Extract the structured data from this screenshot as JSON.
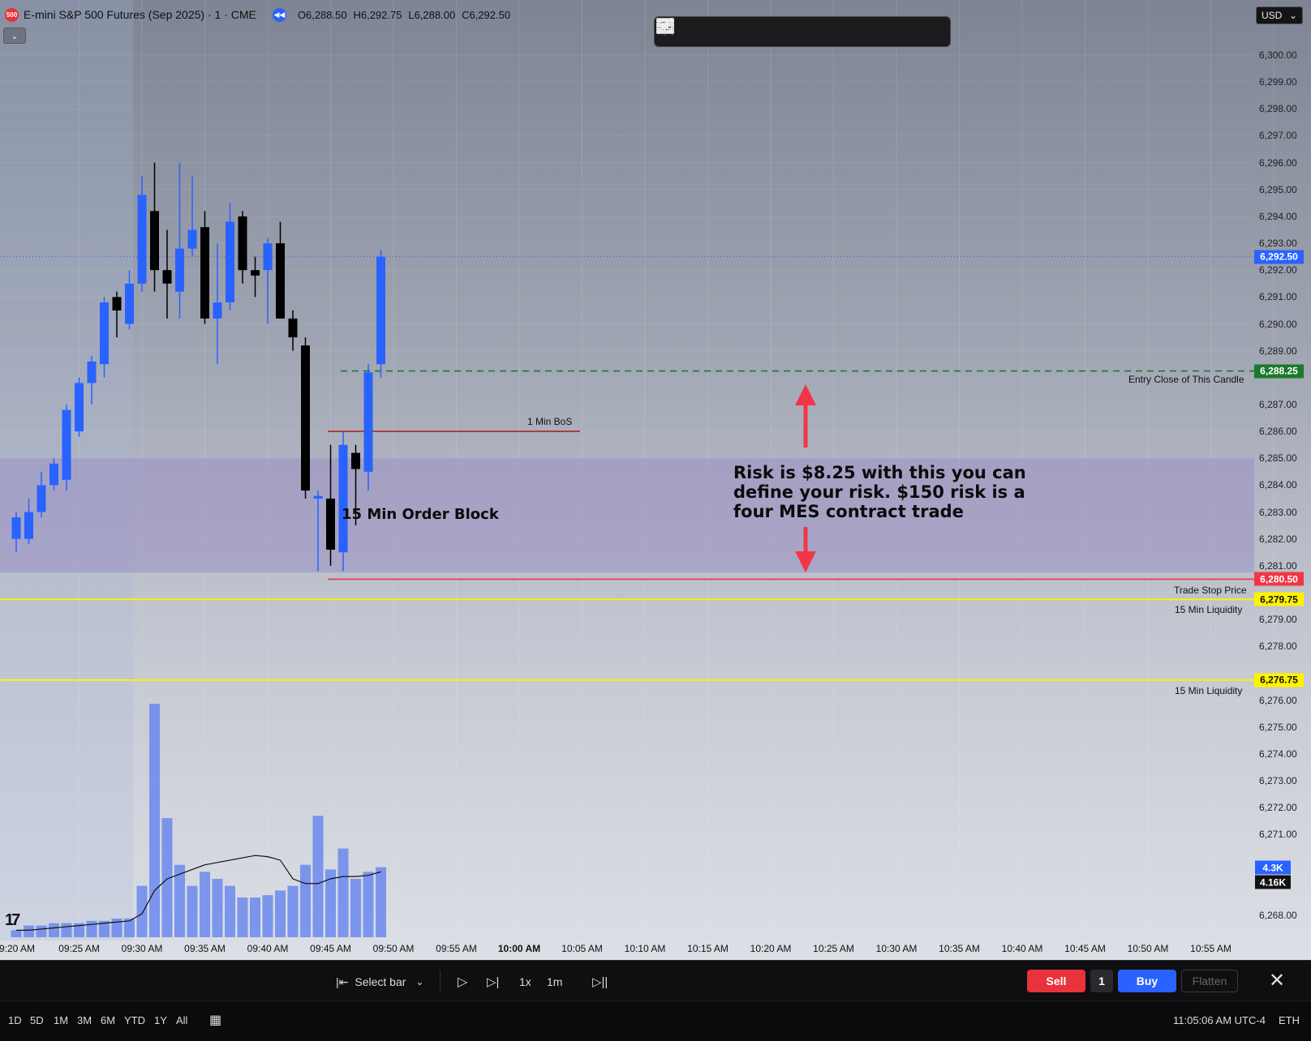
{
  "header": {
    "symbol_badge": "500",
    "title": "E-mini S&P 500 Futures (Sep 2025) · 1 · CME",
    "ohlc": [
      "O6,288.50",
      "H6,292.75",
      "L6,288.00",
      "C6,292.50"
    ],
    "currency": "USD"
  },
  "price_axis": {
    "ticks": [
      "6,300.00",
      "6,299.00",
      "6,298.00",
      "6,297.00",
      "6,296.00",
      "6,295.00",
      "6,294.00",
      "6,293.00",
      "6,292.00",
      "6,291.00",
      "6,290.00",
      "6,289.00",
      "6,287.00",
      "6,286.00",
      "6,285.00",
      "6,284.00",
      "6,283.00",
      "6,282.00",
      "6,281.00",
      "6,279.00",
      "6,278.00",
      "6,276.00",
      "6,275.00",
      "6,274.00",
      "6,273.00",
      "6,272.00",
      "6,271.00",
      "6,268.00"
    ]
  },
  "badges": [
    {
      "price": 6292.5,
      "label": "6,292.50",
      "bg": "#2962ff",
      "fg": "#ffffff"
    },
    {
      "price": 6288.25,
      "label": "6,288.25",
      "bg": "#1b7a2c",
      "fg": "#ffffff"
    },
    {
      "price": 6280.5,
      "label": "6,280.50",
      "bg": "#f23645",
      "fg": "#ffffff"
    },
    {
      "price": 6279.75,
      "label": "6,279.75",
      "bg": "#fff200",
      "fg": "#111111"
    },
    {
      "price": 6276.75,
      "label": "6,276.75",
      "bg": "#fff200",
      "fg": "#111111"
    }
  ],
  "volume_badges": [
    {
      "label": "4.3K",
      "bg": "#2962ff",
      "fg": "#ffffff"
    },
    {
      "label": "4.16K",
      "bg": "#111111",
      "fg": "#ffffff"
    }
  ],
  "time_axis": [
    "9:20 AM",
    "09:25 AM",
    "09:30 AM",
    "09:35 AM",
    "09:40 AM",
    "09:45 AM",
    "09:50 AM",
    "09:55 AM",
    "10:00 AM",
    "10:05 AM",
    "10:10 AM",
    "10:15 AM",
    "10:20 AM",
    "10:25 AM",
    "10:30 AM",
    "10:35 AM",
    "10:40 AM",
    "10:45 AM",
    "10:50 AM",
    "10:55 AM"
  ],
  "annotations": {
    "entry_label": "Entry Close of This Candle",
    "bos_label": "1 Min BoS",
    "order_block_label": "15 Min Order Block",
    "risk_lines": [
      "Risk is $8.25 with this you can",
      "define your risk. $150 risk is a",
      "four MES contract trade"
    ],
    "stop_label": "Trade Stop Price",
    "liquidity_label_1": "15 Min Liquidity",
    "liquidity_label_2": "15 Min Liquidity"
  },
  "colors": {
    "bull": "#2962ff",
    "bear": "#000000",
    "entry_line": "#1b7a2c",
    "stop_line": "#f23645",
    "liquidity_line": "#fff200",
    "order_block": "#9b8fc4",
    "arrow": "#f23645"
  },
  "chart_data": {
    "type": "candlestick",
    "y_range": [
      6267.5,
      6302.0
    ],
    "x_range": [
      "09:20",
      "10:59"
    ],
    "candles": [
      {
        "t": "09:20",
        "o": 6282.0,
        "h": 6283.0,
        "l": 6281.5,
        "c": 6282.8
      },
      {
        "t": "09:21",
        "o": 6282.0,
        "h": 6283.5,
        "l": 6281.8,
        "c": 6283.0
      },
      {
        "t": "09:22",
        "o": 6283.0,
        "h": 6284.5,
        "l": 6282.8,
        "c": 6284.0
      },
      {
        "t": "09:23",
        "o": 6284.0,
        "h": 6285.0,
        "l": 6283.8,
        "c": 6284.8
      },
      {
        "t": "09:24",
        "o": 6284.2,
        "h": 6287.0,
        "l": 6283.8,
        "c": 6286.8
      },
      {
        "t": "09:25",
        "o": 6286.0,
        "h": 6288.0,
        "l": 6285.8,
        "c": 6287.8
      },
      {
        "t": "09:26",
        "o": 6287.8,
        "h": 6288.8,
        "l": 6287.0,
        "c": 6288.6
      },
      {
        "t": "09:27",
        "o": 6288.5,
        "h": 6291.0,
        "l": 6288.0,
        "c": 6290.8
      },
      {
        "t": "09:28",
        "o": 6291.0,
        "h": 6291.2,
        "l": 6289.5,
        "c": 6290.5
      },
      {
        "t": "09:29",
        "o": 6290.0,
        "h": 6292.0,
        "l": 6289.8,
        "c": 6291.5
      },
      {
        "t": "09:30",
        "o": 6291.5,
        "h": 6295.5,
        "l": 6291.2,
        "c": 6294.8
      },
      {
        "t": "09:31",
        "o": 6294.2,
        "h": 6296.0,
        "l": 6291.2,
        "c": 6292.0
      },
      {
        "t": "09:32",
        "o": 6292.0,
        "h": 6293.5,
        "l": 6290.2,
        "c": 6291.5
      },
      {
        "t": "09:33",
        "o": 6291.2,
        "h": 6296.0,
        "l": 6290.2,
        "c": 6292.8
      },
      {
        "t": "09:34",
        "o": 6292.8,
        "h": 6295.5,
        "l": 6292.5,
        "c": 6293.5
      },
      {
        "t": "09:35",
        "o": 6293.6,
        "h": 6294.2,
        "l": 6290.0,
        "c": 6290.2
      },
      {
        "t": "09:36",
        "o": 6290.2,
        "h": 6293.0,
        "l": 6288.5,
        "c": 6290.8
      },
      {
        "t": "09:37",
        "o": 6290.8,
        "h": 6294.5,
        "l": 6290.5,
        "c": 6293.8
      },
      {
        "t": "09:38",
        "o": 6294.0,
        "h": 6294.2,
        "l": 6291.5,
        "c": 6292.0
      },
      {
        "t": "09:39",
        "o": 6292.0,
        "h": 6292.5,
        "l": 6291.0,
        "c": 6291.8
      },
      {
        "t": "09:40",
        "o": 6292.0,
        "h": 6293.2,
        "l": 6290.0,
        "c": 6293.0
      },
      {
        "t": "09:41",
        "o": 6293.0,
        "h": 6293.8,
        "l": 6290.2,
        "c": 6290.2
      },
      {
        "t": "09:42",
        "o": 6290.2,
        "h": 6290.5,
        "l": 6289.0,
        "c": 6289.5
      },
      {
        "t": "09:43",
        "o": 6289.2,
        "h": 6289.5,
        "l": 6283.5,
        "c": 6283.8
      },
      {
        "t": "09:44",
        "o": 6283.5,
        "h": 6283.8,
        "l": 6280.8,
        "c": 6283.6
      },
      {
        "t": "09:45",
        "o": 6283.5,
        "h": 6285.5,
        "l": 6281.0,
        "c": 6281.6
      },
      {
        "t": "09:46",
        "o": 6281.5,
        "h": 6286.0,
        "l": 6280.8,
        "c": 6285.5
      },
      {
        "t": "09:47",
        "o": 6285.2,
        "h": 6285.5,
        "l": 6282.5,
        "c": 6284.6
      },
      {
        "t": "09:48",
        "o": 6284.5,
        "h": 6288.5,
        "l": 6283.8,
        "c": 6288.2
      },
      {
        "t": "09:49",
        "o": 6288.5,
        "h": 6292.75,
        "l": 6288.0,
        "c": 6292.5
      }
    ],
    "volume": [
      0.03,
      0.05,
      0.05,
      0.06,
      0.06,
      0.06,
      0.07,
      0.07,
      0.08,
      0.08,
      0.22,
      1.0,
      0.51,
      0.31,
      0.22,
      0.28,
      0.25,
      0.22,
      0.17,
      0.17,
      0.18,
      0.2,
      0.22,
      0.31,
      0.52,
      0.29,
      0.38,
      0.25,
      0.28,
      0.3
    ],
    "volume_ma": [
      0.03,
      0.03,
      0.035,
      0.04,
      0.045,
      0.05,
      0.055,
      0.06,
      0.065,
      0.07,
      0.1,
      0.2,
      0.25,
      0.27,
      0.29,
      0.31,
      0.32,
      0.33,
      0.34,
      0.35,
      0.345,
      0.33,
      0.25,
      0.23,
      0.23,
      0.25,
      0.26,
      0.26,
      0.265,
      0.28
    ],
    "levels": [
      {
        "name": "Entry Close of This Candle",
        "price": 6288.25
      },
      {
        "name": "1 Min BoS",
        "price": 6286.0
      },
      {
        "name": "Trade Stop Price",
        "price": 6280.5
      },
      {
        "name": "15 Min Liquidity",
        "price": 6279.75
      },
      {
        "name": "15 Min Liquidity",
        "price": 6276.75
      },
      {
        "name": "last",
        "price": 6292.5
      }
    ],
    "order_block": {
      "top": 6285.0,
      "bottom": 6280.75,
      "label": "15 Min Order Block"
    }
  },
  "toolbar_bottom": {
    "select_bar": "Select bar",
    "speed": "1x",
    "interval": "1m",
    "sell": "Sell",
    "qty": "1",
    "buy": "Buy",
    "flatten": "Flatten"
  },
  "status": {
    "ranges": [
      "1D",
      "5D",
      "1M",
      "3M",
      "6M",
      "YTD",
      "1Y",
      "All"
    ],
    "time": "11:05:06 AM UTC-4",
    "session": "ETH"
  }
}
